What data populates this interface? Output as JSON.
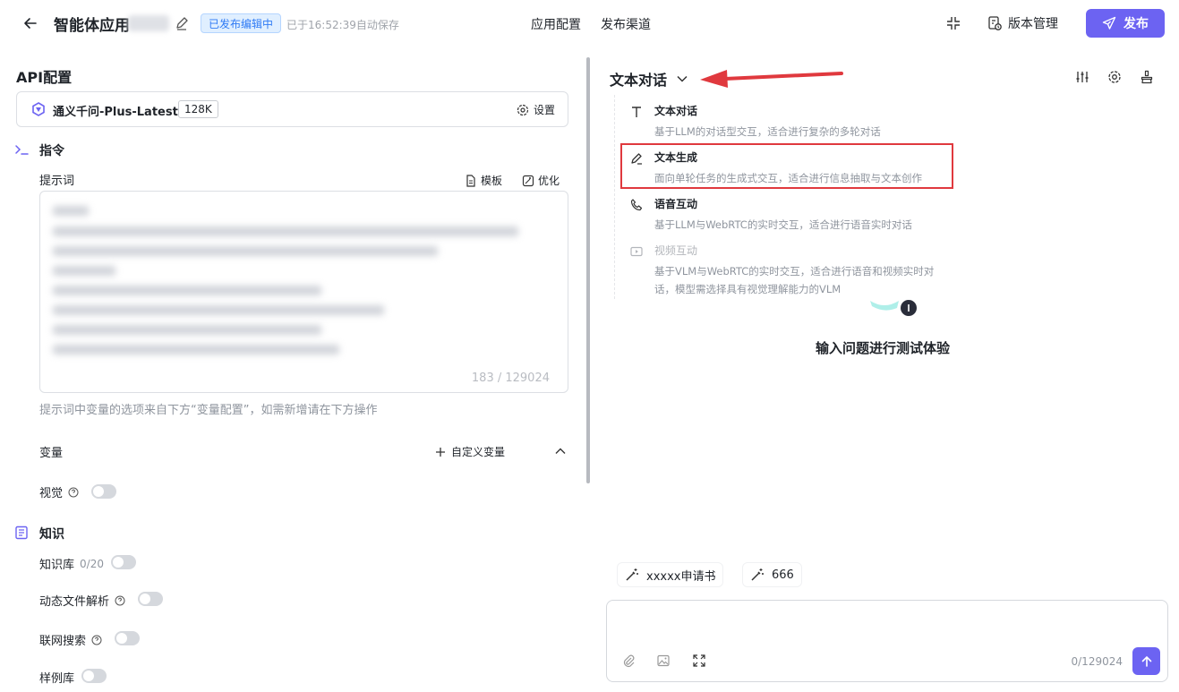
{
  "header": {
    "app_title": "智能体应用",
    "status_badge": "已发布编辑中",
    "autosave": "已于16:52:39自动保存",
    "nav": [
      "应用配置",
      "发布渠道"
    ],
    "version_label": "版本管理",
    "publish_label": "发布"
  },
  "api_config": {
    "title": "API配置",
    "model_name": "通义千问-Plus-Latest",
    "model_context": "128K",
    "settings_label": "设置"
  },
  "instructions": {
    "title": "指令",
    "prompt_label": "提示词",
    "template_label": "模板",
    "optimize_label": "优化",
    "prompt_count": "183 / 129024",
    "prompt_hint": "提示词中变量的选项来自下方“变量配置”，如需新增请在下方操作"
  },
  "variables": {
    "title": "变量",
    "custom_label": "自定义变量",
    "vision_label": "视觉",
    "vision_on": false
  },
  "knowledge": {
    "title": "知识",
    "kb_label": "知识库",
    "kb_count": "0/20",
    "dynamic_label": "动态文件解析",
    "web_search_label": "联网搜索",
    "sample_label": "样例库"
  },
  "mode_selector": {
    "current": "文本对话",
    "options": [
      {
        "title": "文本对话",
        "desc": "基于LLM的对话型交互，适合进行复杂的多轮对话",
        "icon": "text-t-icon",
        "enabled": true
      },
      {
        "title": "文本生成",
        "desc": "面向单轮任务的生成式交互，适合进行信息抽取与文本创作",
        "icon": "pen-icon",
        "enabled": true
      },
      {
        "title": "语音互动",
        "desc": "基于LLM与WebRTC的实时交互，适合进行语音实时对话",
        "icon": "phone-icon",
        "enabled": true
      },
      {
        "title": "视频互动",
        "desc": "基于VLM与WebRTC的实时交互，适合进行语音和视频实时对话，模型需选择具有视觉理解能力的VLM",
        "icon": "video-icon",
        "enabled": false
      }
    ]
  },
  "preview": {
    "empty_text": "输入问题进行测试体验",
    "suggestions": [
      "xxxxx申请书",
      "666"
    ],
    "input_count": "0/129024"
  },
  "colors": {
    "accent": "#6c63f2",
    "badge_bg": "#e0efff",
    "badge_text": "#2f7bf5",
    "annotation_red": "#e0393e"
  }
}
